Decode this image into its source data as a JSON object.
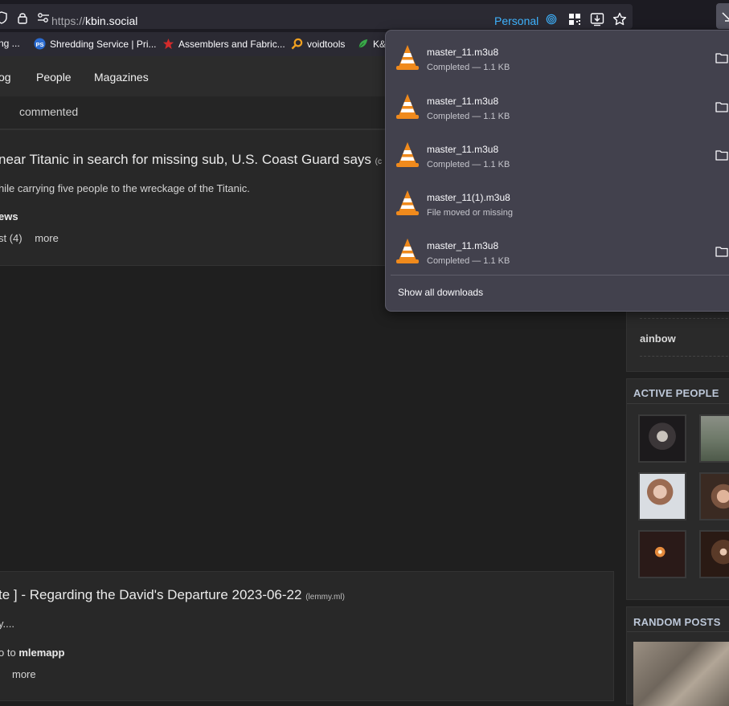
{
  "browser": {
    "url_scheme": "https://",
    "url_host": "kbin.social",
    "container_label": "Personal",
    "bookmarks": [
      {
        "label": "ng ..."
      },
      {
        "label": "Shredding Service | Pri..."
      },
      {
        "label": "Assemblers and Fabric..."
      },
      {
        "label": "voidtools"
      },
      {
        "label": "K&"
      }
    ]
  },
  "page": {
    "nav": [
      "og",
      "People",
      "Magazines"
    ],
    "sub_tab": "commented",
    "entries": [
      {
        "title": " near Titanic in search for missing sub, U.S. Coast Guard says",
        "domain": "(c",
        "body": "hile carrying five people to the wreckage of the Titanic.",
        "magazine": "ews",
        "meta_count": "st (4)",
        "more": "more"
      },
      {
        "title": "te ] - Regarding the David's Departure 2023-06-22",
        "domain": "(lemmy.ml)",
        "body": "y....",
        "to_prefix": "o to",
        "to_magazine": "mlemapp",
        "more": "more"
      }
    ],
    "sidebar": {
      "partial_item": "ainbow",
      "active_people_title": "ACTIVE PEOPLE",
      "random_posts_title": "RANDOM POSTS"
    }
  },
  "downloads": {
    "items": [
      {
        "name": "master_11.m3u8",
        "status": "Completed — 1.1 KB",
        "has_folder": true
      },
      {
        "name": "master_11.m3u8",
        "status": "Completed — 1.1 KB",
        "has_folder": true
      },
      {
        "name": "master_11.m3u8",
        "status": "Completed — 1.1 KB",
        "has_folder": true
      },
      {
        "name": "master_11(1).m3u8",
        "status": "File moved or missing",
        "has_folder": false
      },
      {
        "name": "master_11.m3u8",
        "status": "Completed — 1.1 KB",
        "has_folder": true
      }
    ],
    "show_all": "Show all downloads"
  },
  "colors": {
    "accent_blue": "#3fb4ff",
    "panel_bg": "#42414d",
    "vlc_orange": "#f08a1c"
  }
}
